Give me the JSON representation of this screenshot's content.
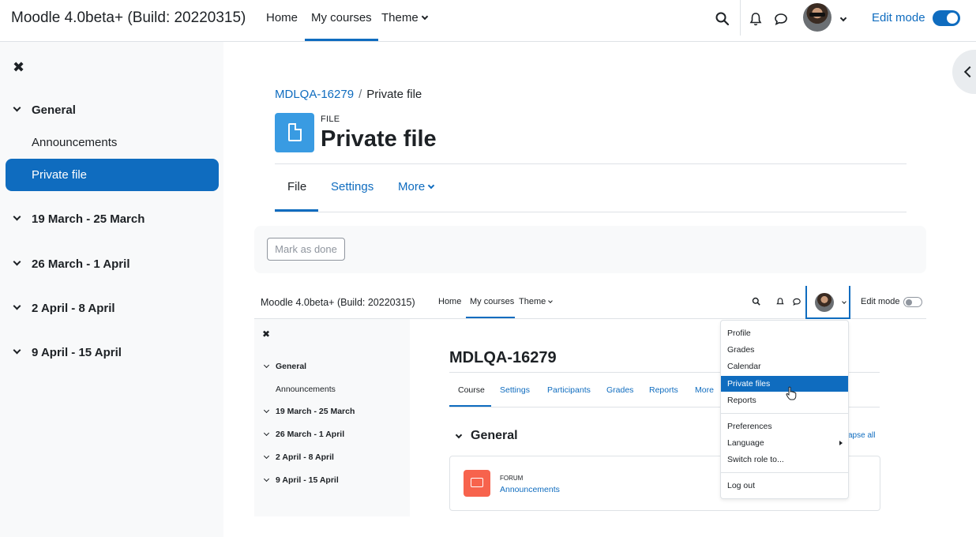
{
  "navbar": {
    "brand": "Moodle 4.0beta+ (Build: 20220315)",
    "items": [
      {
        "label": "Home"
      },
      {
        "label": "My courses"
      },
      {
        "label": "Theme"
      }
    ],
    "edit_mode_label": "Edit mode",
    "edit_mode_on": true
  },
  "drawer": {
    "close_icon": "close-icon",
    "general": "General",
    "announcements": "Announcements",
    "private_file": "Private file",
    "sections": [
      "19 March - 25 March",
      "26 March - 1 April",
      "2 April - 8 April",
      "9 April - 15 April"
    ]
  },
  "breadcrumb": {
    "course": "MDLQA-16279",
    "current": "Private file"
  },
  "header": {
    "module_type": "FILE",
    "title": "Private file",
    "icon": "file-icon"
  },
  "tabs": [
    {
      "label": "File"
    },
    {
      "label": "Settings"
    },
    {
      "label": "More"
    }
  ],
  "completion": {
    "button_label": "Mark as done"
  },
  "screenshot": {
    "brand": "Moodle 4.0beta+ (Build: 20220315)",
    "nav": [
      "Home",
      "My courses",
      "Theme"
    ],
    "edit_mode_label": "Edit mode",
    "drawer": {
      "general": "General",
      "announcements": "Announcements",
      "sections": [
        "19 March - 25 March",
        "26 March - 1 April",
        "2 April - 8 April",
        "9 April - 15 April"
      ]
    },
    "course_title": "MDLQA-16279",
    "tabs": [
      "Course",
      "Settings",
      "Participants",
      "Grades",
      "Reports",
      "More"
    ],
    "section_title": "General",
    "collapse_all": "apse all",
    "activity": {
      "type": "FORUM",
      "name": "Announcements"
    },
    "user_menu": [
      "Profile",
      "Grades",
      "Calendar",
      "Private files",
      "Reports",
      "Preferences",
      "Language",
      "Switch role to...",
      "Log out"
    ],
    "highlighted_item": "Private files"
  },
  "colors": {
    "primary": "#0f6cbf",
    "file_icon": "#399be2",
    "forum_icon": "#f7634d",
    "drawer_bg": "#f8f9fa"
  }
}
